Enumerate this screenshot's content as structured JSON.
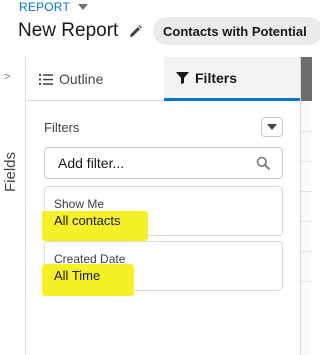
{
  "header": {
    "object_label": "REPORT",
    "title": "New Report",
    "report_type": "Contacts with Potential"
  },
  "rail": {
    "label": "Fields",
    "toggle_glyph": ">"
  },
  "tabs": [
    {
      "label": "Outline",
      "icon": "list-icon",
      "active": false
    },
    {
      "label": "Filters",
      "icon": "funnel-icon",
      "active": true
    }
  ],
  "filters": {
    "heading": "Filters",
    "search_placeholder": "Add filter...",
    "items": [
      {
        "label": "Show Me",
        "value": "All contacts"
      },
      {
        "label": "Created Date",
        "value": "All Time"
      }
    ]
  },
  "colors": {
    "accent": "#0176d3",
    "highlight": "#f3f01a",
    "pill_bg": "#ecebea"
  }
}
